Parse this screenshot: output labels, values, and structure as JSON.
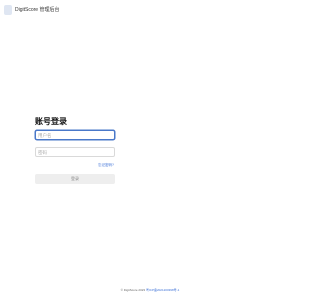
{
  "header": {
    "app_name": "DigitScore 管理后台"
  },
  "login": {
    "title": "账号登录",
    "username_placeholder": "用户名",
    "password_placeholder": "密码",
    "forgot_label": "忘记密码?",
    "submit_label": "登录"
  },
  "footer": {
    "copyright": "© DigitScore 2023 ",
    "icp_link": "粤ICP备2021200398号-1"
  },
  "colors": {
    "accent": "#4a78c9",
    "link": "#3b6fd6",
    "button_bg": "#eeeeee"
  }
}
